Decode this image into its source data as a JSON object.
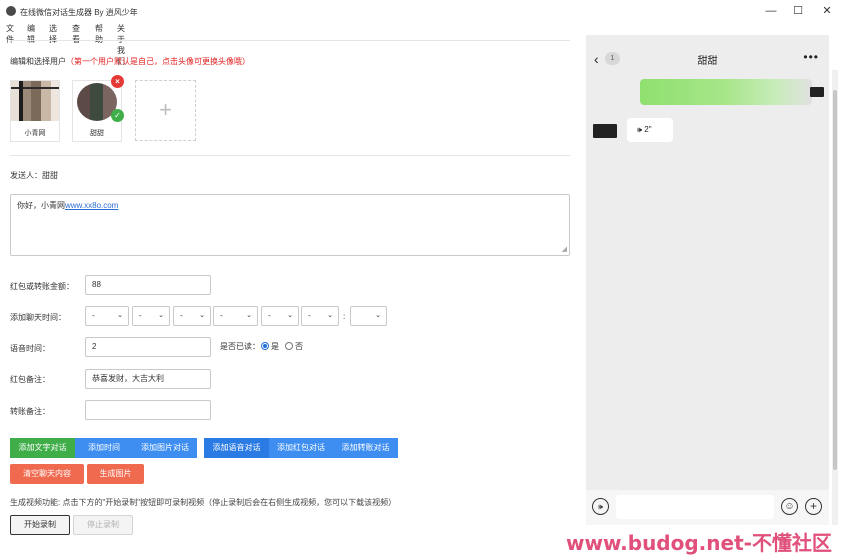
{
  "window": {
    "title": "在线微信对话生成器 By 逍风少年",
    "minimize": "—",
    "maximize": "☐",
    "close": "✕"
  },
  "menu": [
    "文件",
    "编辑",
    "选择",
    "查看",
    "帮助",
    "关于我们"
  ],
  "users": {
    "section_title": "编辑和选择用户",
    "section_hint": "（第一个用户默认是自己，点击头像可更换头像哦）",
    "list": [
      {
        "name": "小青网"
      },
      {
        "name": "甜甜",
        "selected": true
      }
    ],
    "delete_badge": "×",
    "selected_badge": "✓",
    "add_symbol": "+"
  },
  "sender": {
    "label": "发送人：",
    "value": "甜甜"
  },
  "message": {
    "text_prefix": "你好，小青网",
    "link_text": "www.xx8o.com",
    "resize_grip": "◢"
  },
  "form": {
    "redpacket_label": "红包或转账金额：",
    "redpacket_value": "88",
    "time_label": "添加聊天时间：",
    "time_selects": [
      "-",
      "-",
      "-",
      "-",
      "-",
      "-"
    ],
    "time_colon": ":",
    "time_last_select": "",
    "select_caret": "⌄",
    "voice_label": "语音时间：",
    "voice_value": "2",
    "read_label": "是否已读：",
    "read_yes": "是",
    "read_no": "否",
    "read_selected": "是",
    "redpacket_note_label": "红包备注：",
    "redpacket_note_value": "恭喜发财，大吉大利",
    "transfer_note_label": "转账备注：",
    "transfer_note_value": ""
  },
  "buttons": {
    "add_text": "添加文字对话",
    "add_time": "添加时间",
    "add_image": "添加图片对话",
    "add_voice": "添加语音对话",
    "add_redpacket": "添加红包对话",
    "add_transfer": "添加转账对话",
    "clear": "清空聊天内容",
    "generate": "生成图片"
  },
  "video": {
    "note": "生成视频功能: 点击下方的\"开始录制\"按钮即可录制视频（停止录制后会在右侧生成视频，您可以下载该视频）",
    "start": "开始录制",
    "stop": "停止录制"
  },
  "phone": {
    "back_icon": "‹",
    "unread_count": "1",
    "chat_title": "甜甜",
    "more_icon": "•••",
    "voice_message": "2\"",
    "voice_wave": "🕪",
    "voice_toggle_icon": "🕪",
    "emoji_icon": "☺",
    "plus_icon": "+"
  },
  "watermark": "www.budog.net-不懂社区"
}
